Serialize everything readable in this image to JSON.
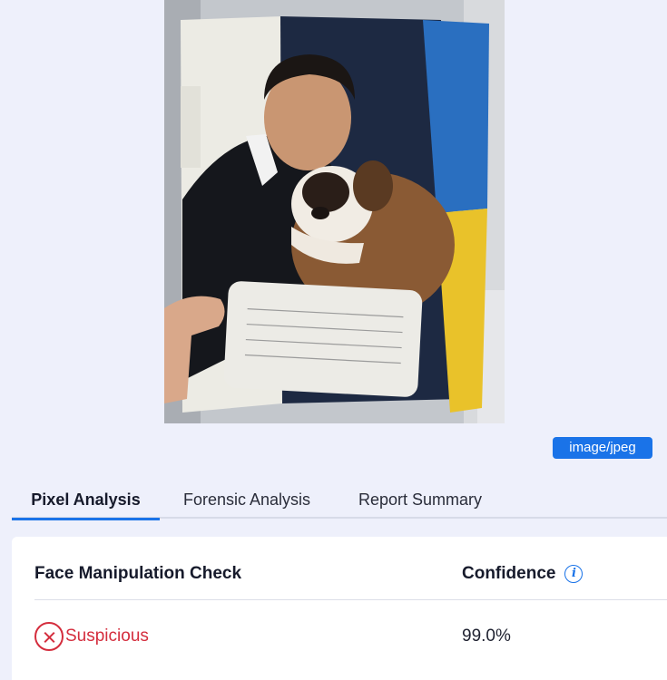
{
  "preview": {
    "badge": "image/jpeg"
  },
  "tabs": [
    {
      "label": "Pixel Analysis",
      "active": true
    },
    {
      "label": "Forensic Analysis",
      "active": false
    },
    {
      "label": "Report Summary",
      "active": false
    }
  ],
  "results": {
    "check_header": "Face Manipulation Check",
    "confidence_header": "Confidence",
    "status_label": "Suspicious",
    "confidence_value": "99.0%"
  },
  "colors": {
    "accent": "#1a73e8",
    "danger": "#d42d3d",
    "background": "#eef0fb"
  }
}
